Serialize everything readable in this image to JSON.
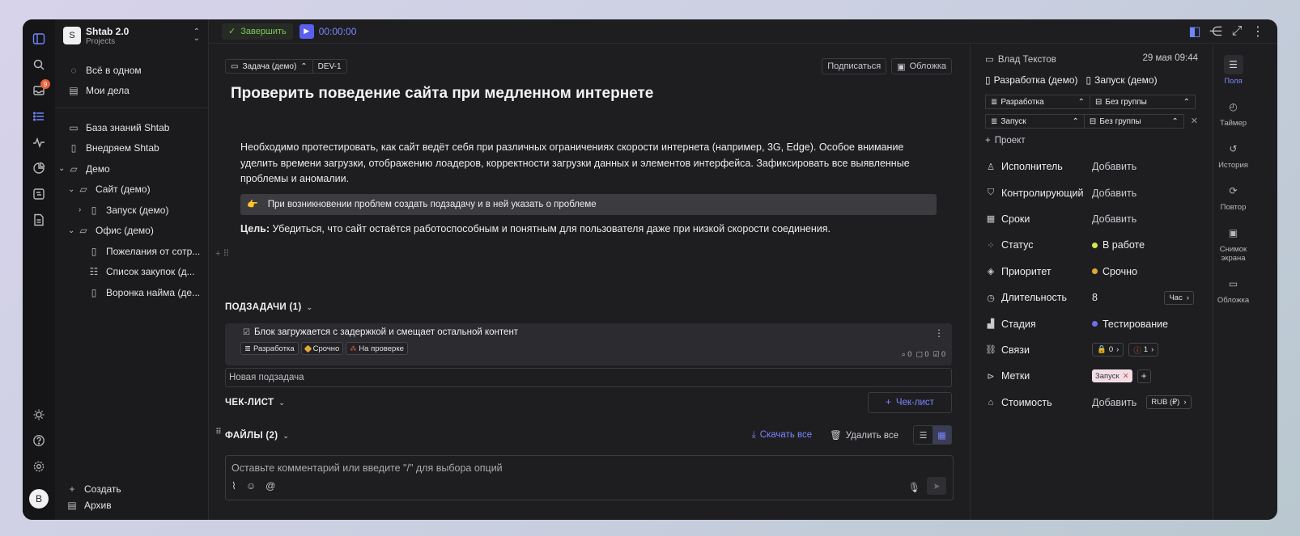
{
  "workspace": {
    "name": "Shtab 2.0",
    "subtitle": "Projects",
    "logo_letter": "S"
  },
  "rail": {
    "inbox_badge": "9",
    "avatar_letter": "B"
  },
  "sidebar": {
    "top": [
      {
        "label": "Всё в одном",
        "icon": "circle-dots-icon"
      },
      {
        "label": "Мои дела",
        "icon": "list-icon"
      }
    ],
    "tree": [
      {
        "label": "База знаний Shtab"
      },
      {
        "label": "Внедряем Shtab"
      },
      {
        "label": "Демо"
      },
      {
        "label": "Сайт (демо)"
      },
      {
        "label": "Запуск (демо)"
      },
      {
        "label": "Офис (демо)"
      },
      {
        "label": "Пожелания от сотр..."
      },
      {
        "label": "Список закупок (д..."
      },
      {
        "label": "Воронка найма (де..."
      }
    ],
    "create_label": "Создать",
    "archive_label": "Архив"
  },
  "topbar": {
    "finish_label": "Завершить",
    "timer": "00:00:00"
  },
  "task": {
    "type_label": "Задача (демо)",
    "id": "DEV-1",
    "subscribe_label": "Подписаться",
    "cover_label": "Обложка",
    "title": "Проверить поведение сайта при медленном интернете",
    "description": "Необходимо протестировать, как сайт ведёт себя при различных ограничениях скорости интернета (например, 3G, Edge). Особое внимание уделить времени загрузки, отображению лоадеров, корректности загрузки данных и элементов интерфейса. Зафиксировать все выявленные проблемы и аномалии.",
    "callout_emoji": "👉",
    "callout": "При возникновении проблем создать подзадачу и в ней указать о проблеме",
    "goal_label": "Цель:",
    "goal_text": "Убедиться, что сайт остаётся работоспособным и понятным для пользователя даже при низкой скорости соединения."
  },
  "subtasks": {
    "header": "ПОДЗАДАЧИ (1)",
    "items": [
      {
        "title": "Блок загружается с задержкой и смещает остальной контент",
        "tags": [
          "Разработка",
          "Срочно",
          "На проверке"
        ],
        "attachments": "0",
        "comments": "0",
        "checks": "0"
      }
    ],
    "new_placeholder": "Новая подзадача"
  },
  "checklist": {
    "header": "ЧЕК-ЛИСТ",
    "add_label": "Чек-лист"
  },
  "files": {
    "header": "ФАЙЛЫ (2)",
    "download_all": "Скачать все",
    "delete_all": "Удалить все"
  },
  "comment": {
    "placeholder": "Оставьте комментарий или введите \"/\" для выбора опций"
  },
  "props": {
    "author": "Влад Текстов",
    "date": "29 мая 09:44",
    "project1": "Разработка (демо)",
    "project2": "Запуск (демо)",
    "pairs": [
      {
        "project": "Разработка",
        "group": "Без группы"
      },
      {
        "project": "Запуск",
        "group": "Без группы"
      }
    ],
    "add_project": "Проект",
    "fields": [
      {
        "label": "Исполнитель",
        "value": "Добавить"
      },
      {
        "label": "Контролирующий",
        "value": "Добавить"
      },
      {
        "label": "Сроки",
        "value": "Добавить"
      },
      {
        "label": "Статус",
        "value": "В работе"
      },
      {
        "label": "Приоритет",
        "value": "Срочно"
      },
      {
        "label": "Длительность",
        "value": "8",
        "unit": "Час"
      },
      {
        "label": "Стадия",
        "value": "Тестирование"
      },
      {
        "label": "Связи",
        "link_a": "0",
        "link_b": "1"
      },
      {
        "label": "Метки",
        "value": "Запуск"
      },
      {
        "label": "Стоимость",
        "value": "Добавить",
        "currency": "RUB (₽)"
      }
    ]
  },
  "tabs": [
    {
      "label": "Поля"
    },
    {
      "label": "Таймер"
    },
    {
      "label": "История"
    },
    {
      "label": "Повтор"
    },
    {
      "label": "Снимок экрана"
    },
    {
      "label": "Обложка"
    }
  ],
  "colors": {
    "accent": "#6f86ff",
    "status_in_progress": "#d8e64a",
    "priority_urgent": "#e0a83a",
    "stage_testing": "#6d6ff0",
    "finish_green": "#7bc75a"
  }
}
